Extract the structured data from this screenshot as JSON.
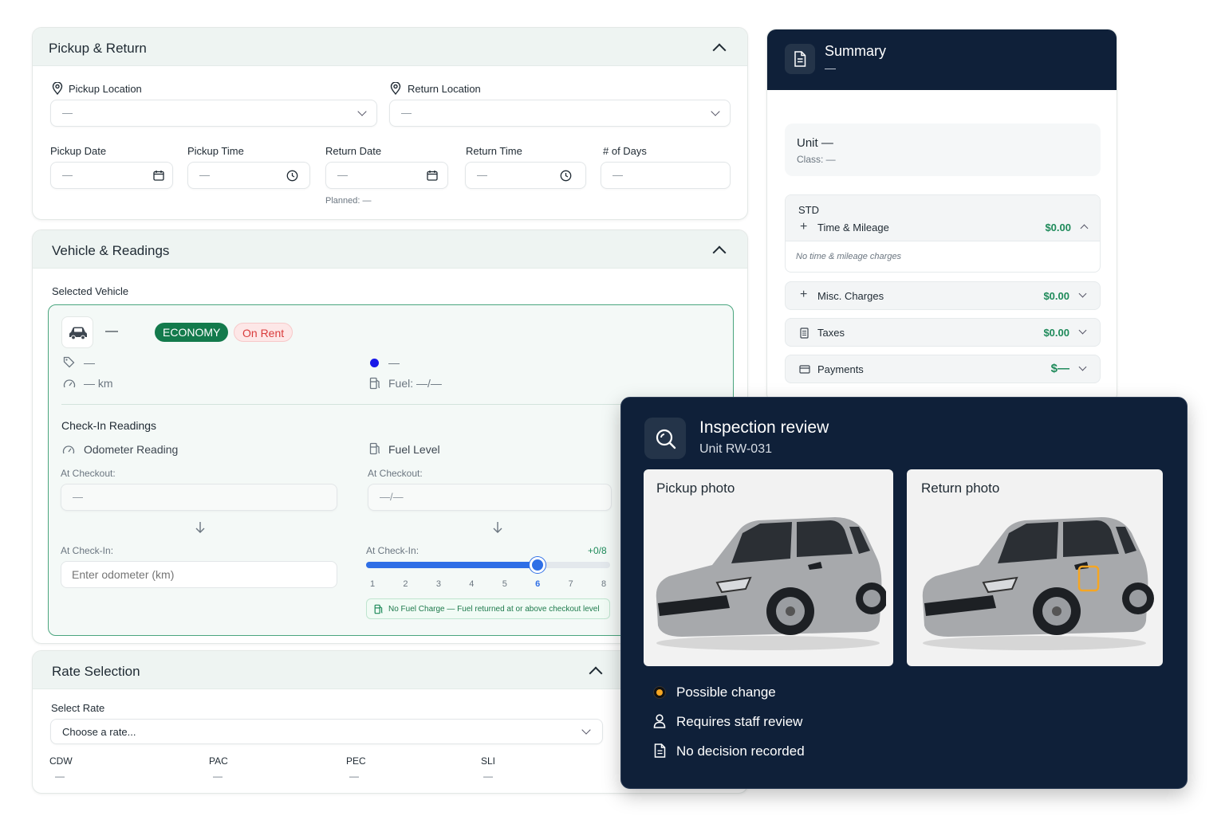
{
  "pickup_return": {
    "title": "Pickup & Return",
    "pickup_location_label": "Pickup Location",
    "pickup_location_value": "—",
    "return_location_label": "Return Location",
    "return_location_value": "—",
    "pickup_date_label": "Pickup Date",
    "pickup_date_value": "—",
    "pickup_time_label": "Pickup Time",
    "pickup_time_value": "—",
    "return_date_label": "Return Date",
    "return_date_value": "—",
    "return_time_label": "Return Time",
    "return_time_value": "—",
    "days_label": "# of Days",
    "days_value": "—",
    "planned_text": "Planned: —"
  },
  "vehicle": {
    "title": "Vehicle & Readings",
    "selected_label": "Selected Vehicle",
    "name": "—",
    "class_badge": "ECONOMY",
    "status_badge": "On Rent",
    "tag_value": "—",
    "color_value": "—",
    "mileage_value": "— km",
    "fuel_value": "Fuel: —/—",
    "checkin_title": "Check-In Readings",
    "odometer_label": "Odometer Reading",
    "fuel_level_label": "Fuel Level",
    "odo_checkout_label": "At Checkout:",
    "odo_checkout_value": "—",
    "fuel_checkout_label": "At Checkout:",
    "fuel_checkout_value": "—/—",
    "odo_checkin_label": "At Check-In:",
    "odo_checkin_placeholder": "Enter odometer (km)",
    "fuel_checkin_label": "At Check-In:",
    "fuel_delta": "+0/8",
    "fuel_level": 6,
    "fuel_max": 8,
    "fuel_ticks": [
      "1",
      "2",
      "3",
      "4",
      "5",
      "6",
      "7",
      "8"
    ],
    "fuel_note": "No Fuel Charge — Fuel returned at or above checkout level"
  },
  "rate": {
    "title": "Rate Selection",
    "select_label": "Select Rate",
    "select_value": "Choose a rate...",
    "cols": [
      {
        "label": "CDW",
        "value": "—"
      },
      {
        "label": "PAC",
        "value": "—"
      },
      {
        "label": "PEC",
        "value": "—"
      },
      {
        "label": "SLI",
        "value": "—"
      }
    ]
  },
  "summary": {
    "title": "Summary",
    "subtitle": "—",
    "unit": "Unit —",
    "class": "Class: —",
    "std_label": "STD",
    "time_mileage": {
      "label": "Time & Mileage",
      "amount": "$0.00",
      "note": "No time & mileage charges"
    },
    "misc": {
      "label": "Misc. Charges",
      "amount": "$0.00"
    },
    "taxes": {
      "label": "Taxes",
      "amount": "$0.00"
    },
    "payments": {
      "label": "Payments",
      "amount": "$—"
    }
  },
  "inspection": {
    "title": "Inspection review",
    "unit": "Unit RW-031",
    "pickup_photo": "Pickup photo",
    "return_photo": "Return photo",
    "statuses": [
      {
        "icon": "orange-dot-icon",
        "text": "Possible change"
      },
      {
        "icon": "person-icon",
        "text": "Requires staff review"
      },
      {
        "icon": "document-icon",
        "text": "No decision recorded"
      }
    ]
  },
  "colors": {
    "navy": "#0f2039",
    "accent_green": "#1e8a5a",
    "economy_badge": "#137a4c",
    "on_rent_bg": "#fde7e7",
    "on_rent_text": "#d93b3b",
    "slider_blue": "#2f6fe6",
    "orange": "#f5a623"
  }
}
